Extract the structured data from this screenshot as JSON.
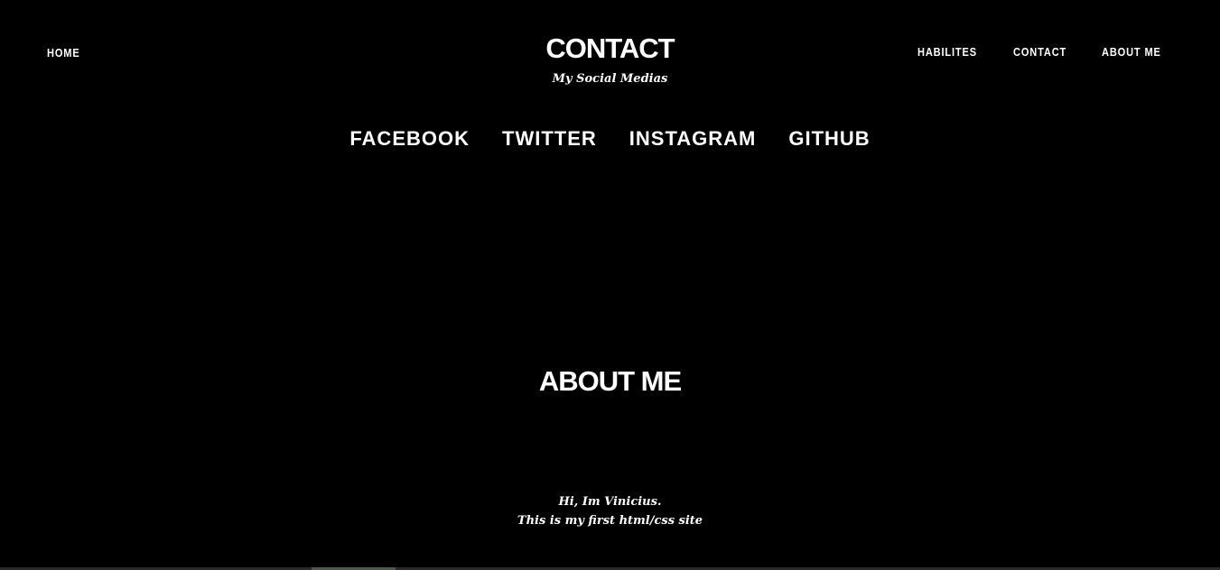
{
  "nav": {
    "left": [
      {
        "label": "HOME"
      }
    ],
    "right": [
      {
        "label": "HABILITES"
      },
      {
        "label": "CONTACT"
      },
      {
        "label": "ABOUT ME"
      }
    ]
  },
  "contact": {
    "title": "CONTACT",
    "subtitle": "My Social Medias",
    "socials": [
      {
        "label": "FACEBOOK"
      },
      {
        "label": "TWITTER"
      },
      {
        "label": "INSTAGRAM"
      },
      {
        "label": "GITHUB"
      }
    ]
  },
  "about": {
    "title": "ABOUT ME",
    "line1": "Hi, Im Vinicius.",
    "line2": "This is my first html/css site"
  },
  "colors": {
    "background": "#000000",
    "text": "#ffffff"
  }
}
